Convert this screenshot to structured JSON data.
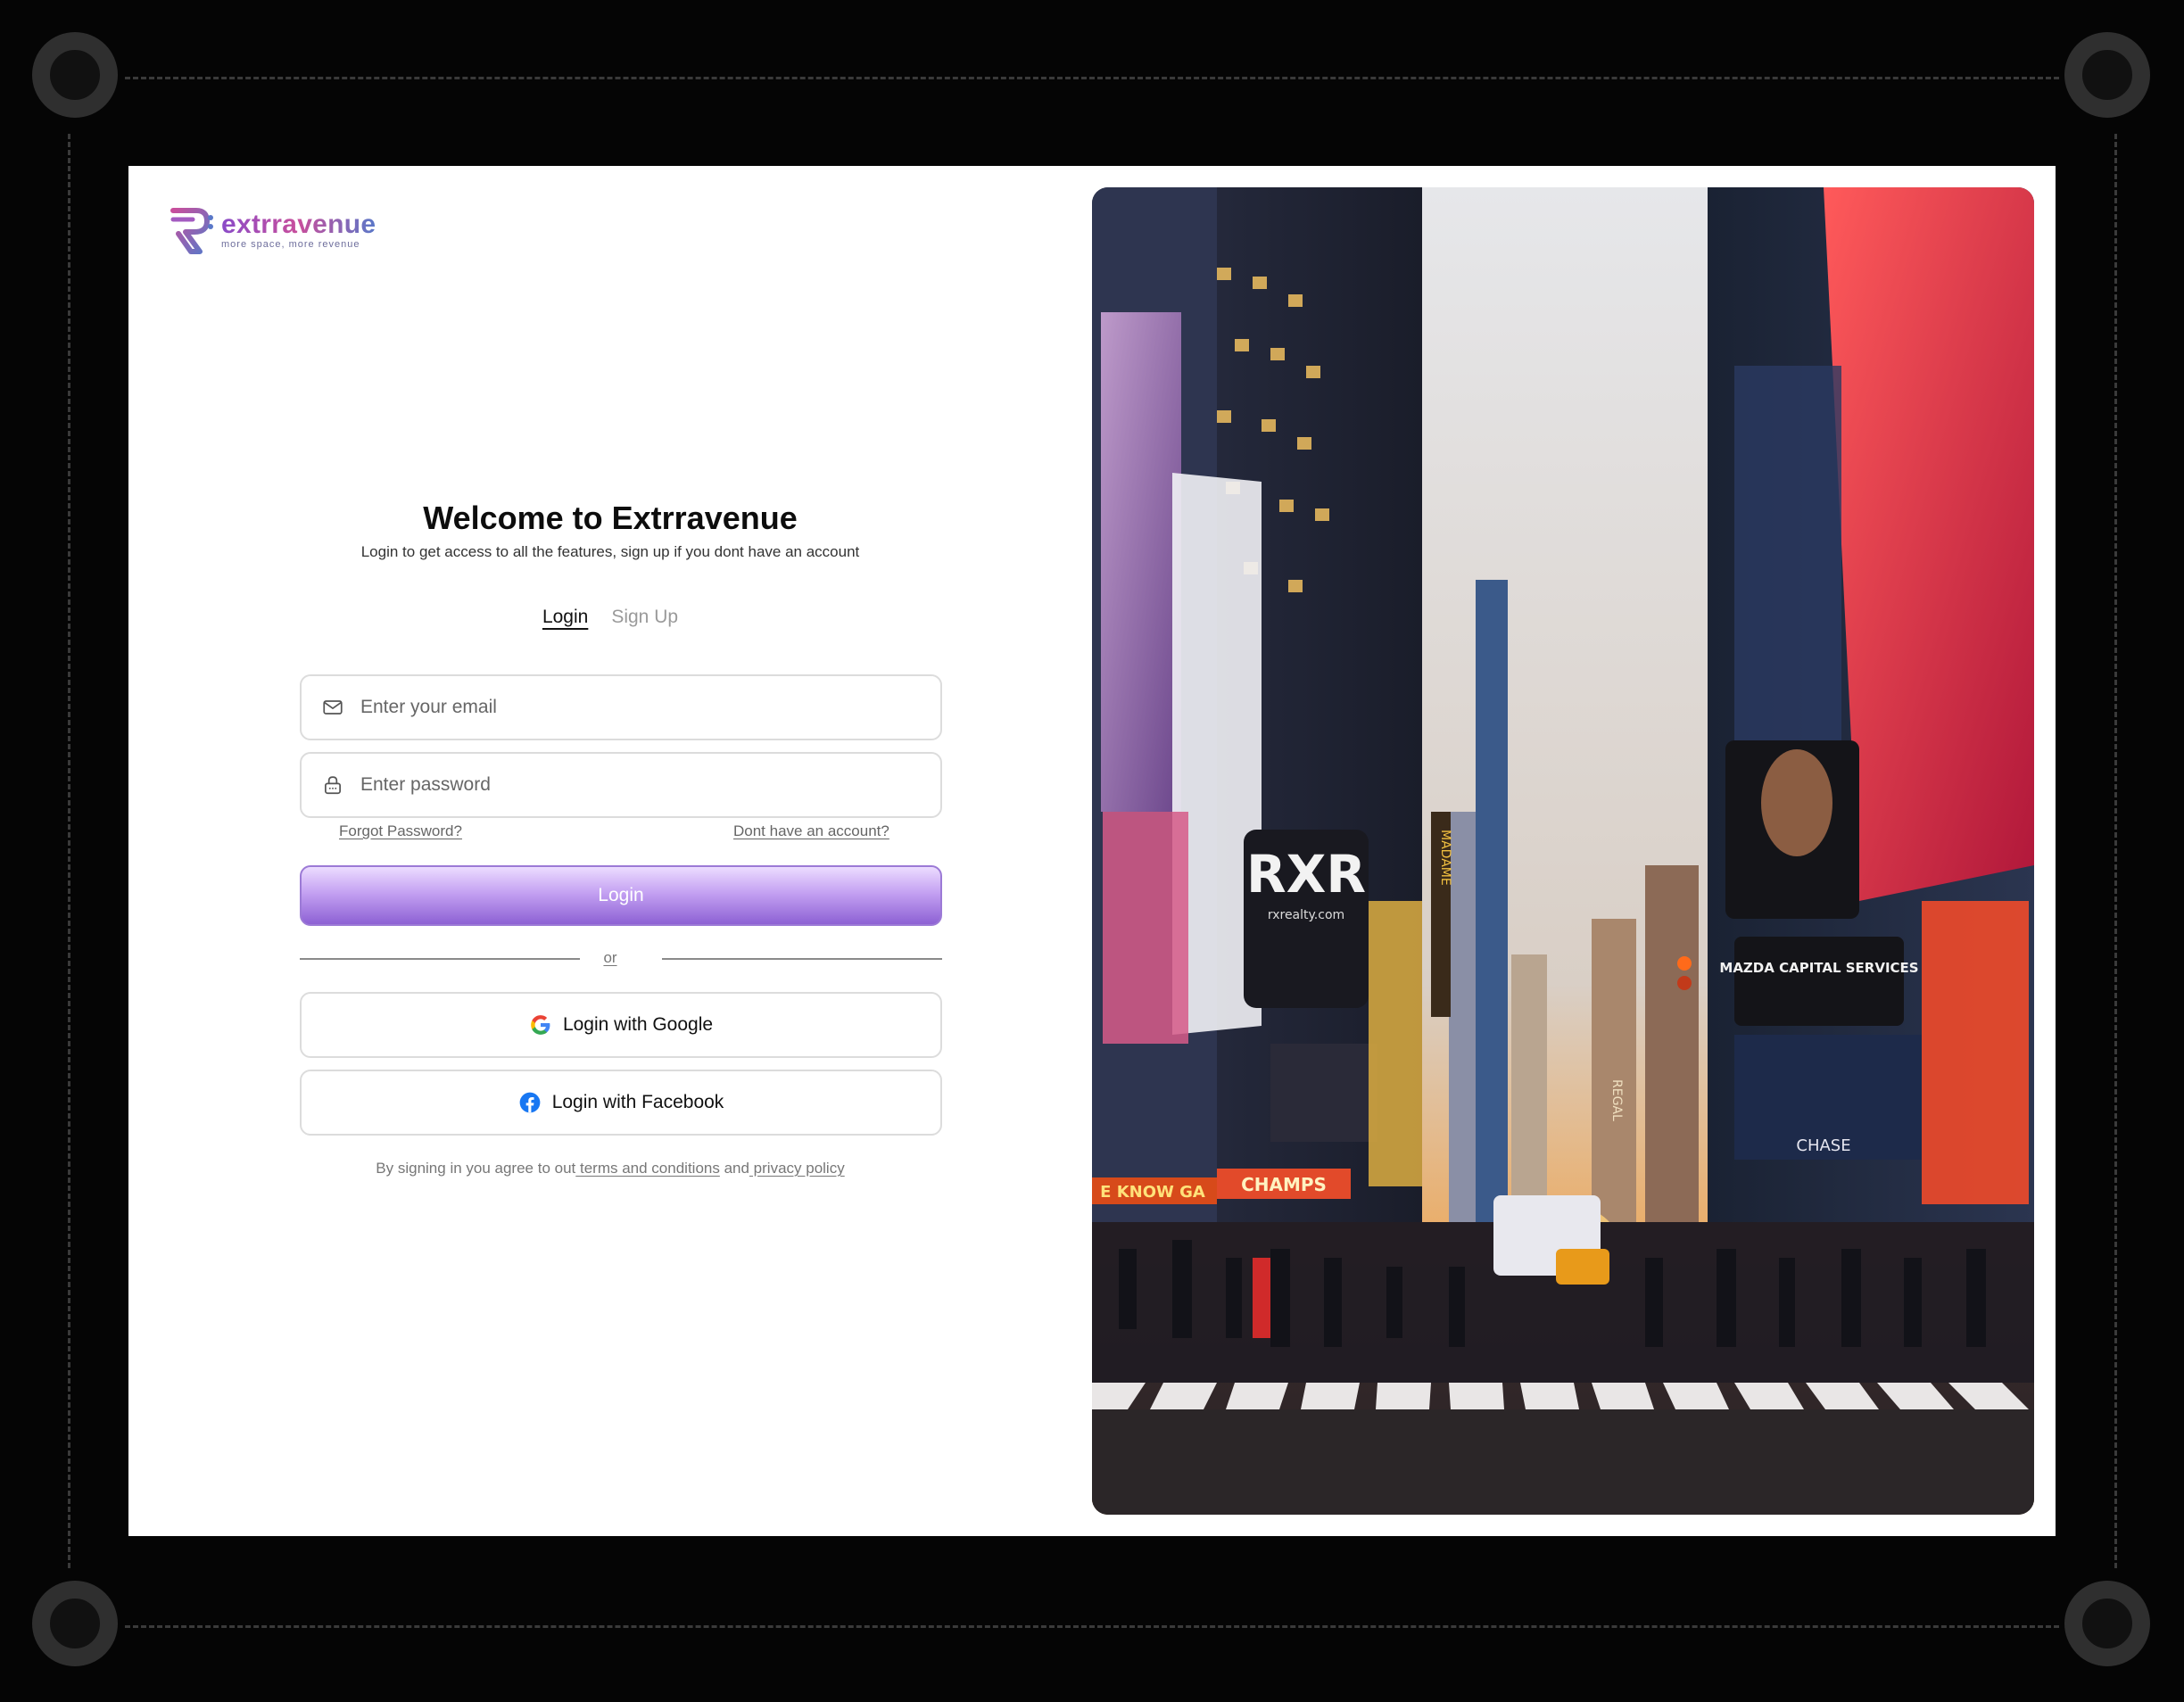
{
  "brand": {
    "name": "extrravenue",
    "tagline": "more space, more revenue"
  },
  "auth": {
    "title": "Welcome to Extrravenue",
    "subtitle": "Login to get access to all the features, sign up if you dont have an account",
    "tabs": [
      {
        "label": "Login",
        "active": true
      },
      {
        "label": "Sign Up",
        "active": false
      }
    ],
    "email": {
      "placeholder": "Enter your email",
      "icon": "mail-icon"
    },
    "password": {
      "placeholder": "Enter password",
      "icon": "lock-icon"
    },
    "forgot_label": "Forgot Password?",
    "no_account_label": "Dont have an account?",
    "login_label": "Login",
    "or_label": "or",
    "google_label": "Login with Google",
    "facebook_label": "Login with Facebook",
    "terms": {
      "prefix": "By signing in you agree to out",
      "terms_link": " terms and conditions",
      "middle": " and",
      "privacy_link": " privacy policy"
    }
  },
  "photo": {
    "sign_rxr": "RXR",
    "sign_rxr_sub": "rxrealty.com",
    "sign_champs": "CHAMPS",
    "sign_madame": "MADAME",
    "sign_mazda": "MAZDA CAPITAL SERVICES",
    "sign_chase": "CHASE",
    "sign_know": "E KNOW GA",
    "sign_regal": "REGAL"
  },
  "colors": {
    "accent": "#9b6ee0",
    "brand_purple": "#8a4bc8",
    "brand_pink": "#c84e9c",
    "google_blue": "#4285F4",
    "facebook_blue": "#1877F2"
  }
}
